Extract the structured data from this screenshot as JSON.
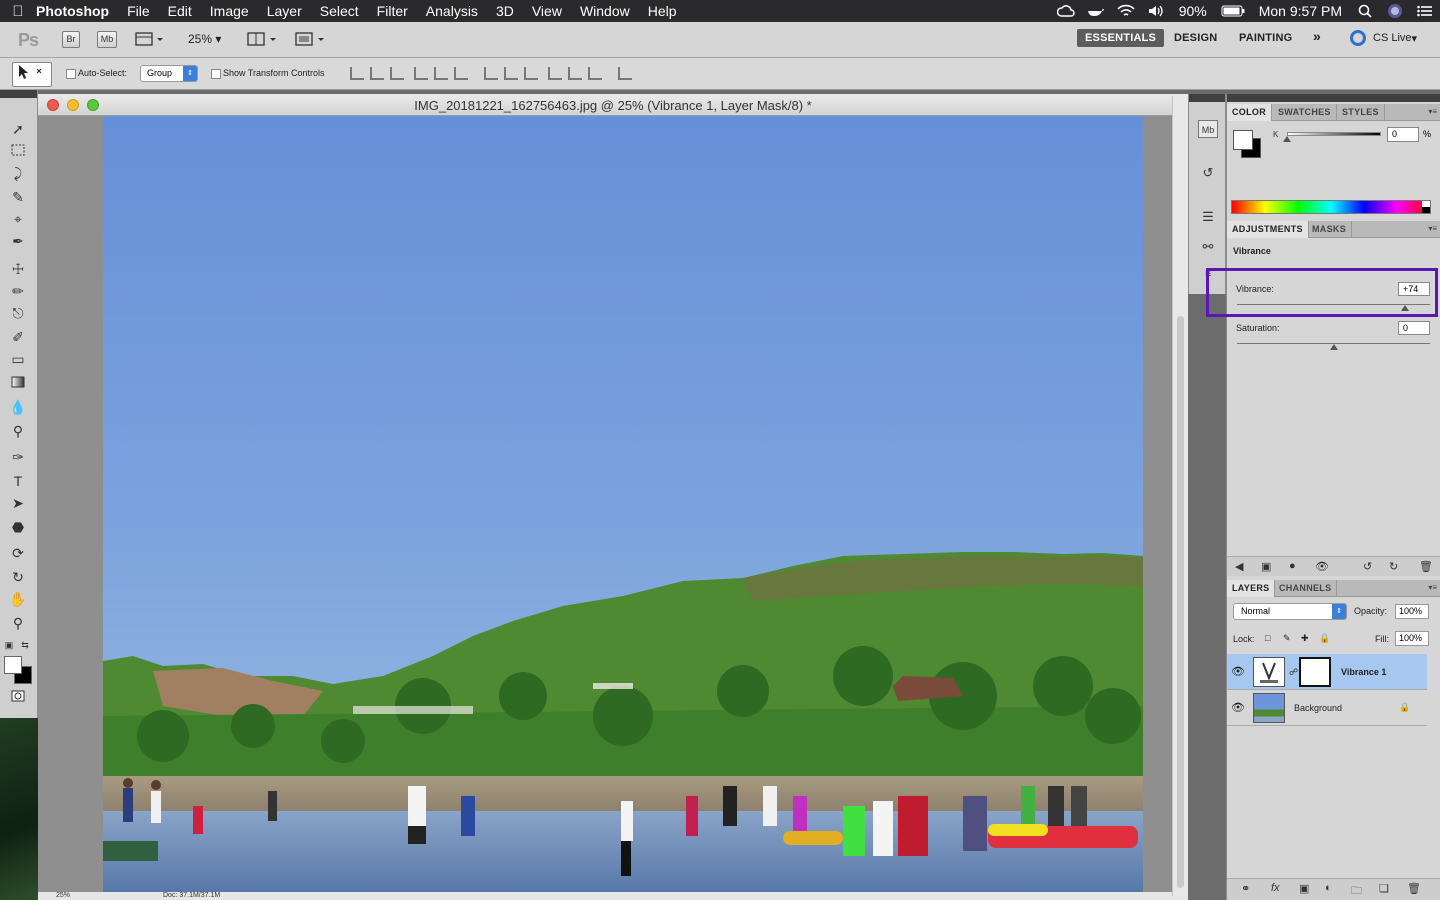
{
  "menubar": {
    "app_name": "Photoshop",
    "items": [
      "File",
      "Edit",
      "Image",
      "Layer",
      "Select",
      "Filter",
      "Analysis",
      "3D",
      "View",
      "Window",
      "Help"
    ],
    "battery": "90%",
    "clock": "Mon 9:57 PM"
  },
  "appbar": {
    "ps_logo": "Ps",
    "bridge": "Br",
    "minibridge": "Mb",
    "zoom": "25%",
    "workspaces": [
      "ESSENTIALS",
      "DESIGN",
      "PAINTING"
    ],
    "more": "»",
    "cs_live": "CS Live"
  },
  "options": {
    "auto_select_label": "Auto-Select:",
    "auto_select_value": "Group",
    "transform_label": "Show Transform Controls"
  },
  "document": {
    "title": "IMG_20181221_162756463.jpg @ 25% (Vibrance 1, Layer Mask/8) *",
    "status_zoom": "25%",
    "status_doc": "Doc: 37.1M/37.1M"
  },
  "color_panel": {
    "tabs": [
      "COLOR",
      "SWATCHES",
      "STYLES"
    ],
    "k_label": "K",
    "k_value": "0",
    "pct": "%",
    "foreground": "#ffffff",
    "background": "#000000"
  },
  "adjustments": {
    "tabs": [
      "ADJUSTMENTS",
      "MASKS"
    ],
    "title": "Vibrance",
    "vibrance_label": "Vibrance:",
    "vibrance_value": "+74",
    "saturation_label": "Saturation:",
    "saturation_value": "0",
    "vibrance_level": 74,
    "saturation_level": 0
  },
  "layers_panel": {
    "tabs": [
      "LAYERS",
      "CHANNELS"
    ],
    "blend_mode": "Normal",
    "opacity_label": "Opacity:",
    "opacity": "100%",
    "lock_label": "Lock:",
    "fill_label": "Fill:",
    "fill": "100%",
    "layers": [
      {
        "name": "Vibrance 1",
        "selected": true
      },
      {
        "name": "Background",
        "selected": false
      }
    ]
  },
  "colors": {
    "highlight": "#5b17b3",
    "selection": "#a5c7f0"
  }
}
